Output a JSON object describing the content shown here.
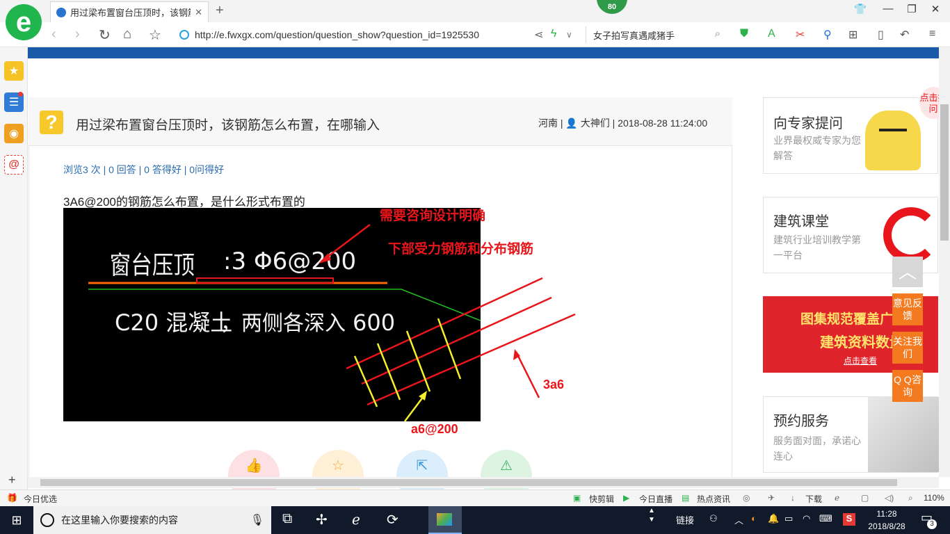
{
  "browser": {
    "tab_title": "用过梁布置窗台压顶时，该钢筋怎",
    "tab_close": "✕",
    "new_tab": "+",
    "score_badge": "80",
    "url": "http://e.fwxgx.com/question/question_show?question_id=1925530",
    "search_text": "女子拍写真遇咸猪手"
  },
  "question": {
    "title": "用过梁布置窗台压顶时，该钢筋怎么布置，在哪输入",
    "region": "河南",
    "author": "大神们",
    "datetime": "2018-08-28 11:24:00",
    "stats": "浏览3 次 | 0 回答 | 0 答得好 | 0问得好",
    "body": "3A6@200的钢筋怎么布置，是什么形式布置的"
  },
  "cad": {
    "label1": "窗台压顶",
    "label2": ":3  Φ6@200",
    "label3": "C20 混凝土",
    "label4": "，两侧各深入",
    "label5": "600"
  },
  "annotations": {
    "a1": "需要咨询设计明确",
    "a2": "下部受力钢筋和分布钢筋",
    "a3": "3a6",
    "a4": "a6@200"
  },
  "right": {
    "card1_title": "向专家提问",
    "card1_sub": "业界最权威专家为您解答",
    "card1_bubble": "点击提问",
    "card2_title": "建筑课堂",
    "card2_sub": "建筑行业培训教学第一平台",
    "banner_l1": "图集规范覆盖广",
    "banner_l2": "建筑资料数量",
    "banner_l3": "点击查看",
    "card3_title": "预约服务",
    "card3_sub": "服务面对面，承诺心连心",
    "feedback": "意见反馈",
    "follow": "关注我们",
    "qq": "Q Q咨询"
  },
  "statusbar": {
    "left": "今日优选",
    "items": [
      "快剪辑",
      "今日直播",
      "热点资讯",
      "下载",
      "110%"
    ]
  },
  "taskbar": {
    "search_placeholder": "在这里输入你要搜索的内容",
    "tray_label": "链接",
    "time": "11:28",
    "date": "2018/8/28",
    "notifications": "3"
  },
  "colors": {
    "accent_blue": "#1a5aa9",
    "annotation_red": "#e8161b",
    "rebar_yellow": "#f5f02a",
    "orange": "#f47a20"
  }
}
